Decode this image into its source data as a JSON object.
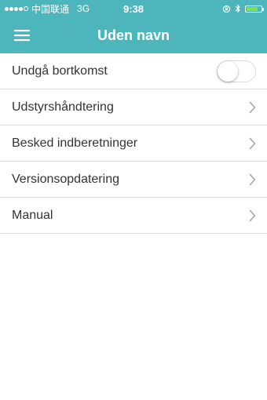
{
  "status_bar": {
    "carrier": "中国联通",
    "network": "3G",
    "time": "9:38",
    "signal_bars_filled": 4,
    "signal_bars_total": 5,
    "battery_level": 0.8,
    "battery_color": "#7ee24b"
  },
  "header": {
    "title": "Uden navn",
    "background": "#4db6bd",
    "menu_icon": "hamburger-menu-icon"
  },
  "settings": {
    "toggle_row": {
      "label": "Undgå bortkomst",
      "enabled": false
    },
    "items": [
      {
        "label": "Udstyrshåndtering",
        "icon": "chevron-right-icon"
      },
      {
        "label": "Besked indberetninger",
        "icon": "chevron-right-icon"
      },
      {
        "label": "Versionsopdatering",
        "icon": "chevron-right-icon"
      },
      {
        "label": "Manual",
        "icon": "chevron-right-icon"
      }
    ]
  }
}
